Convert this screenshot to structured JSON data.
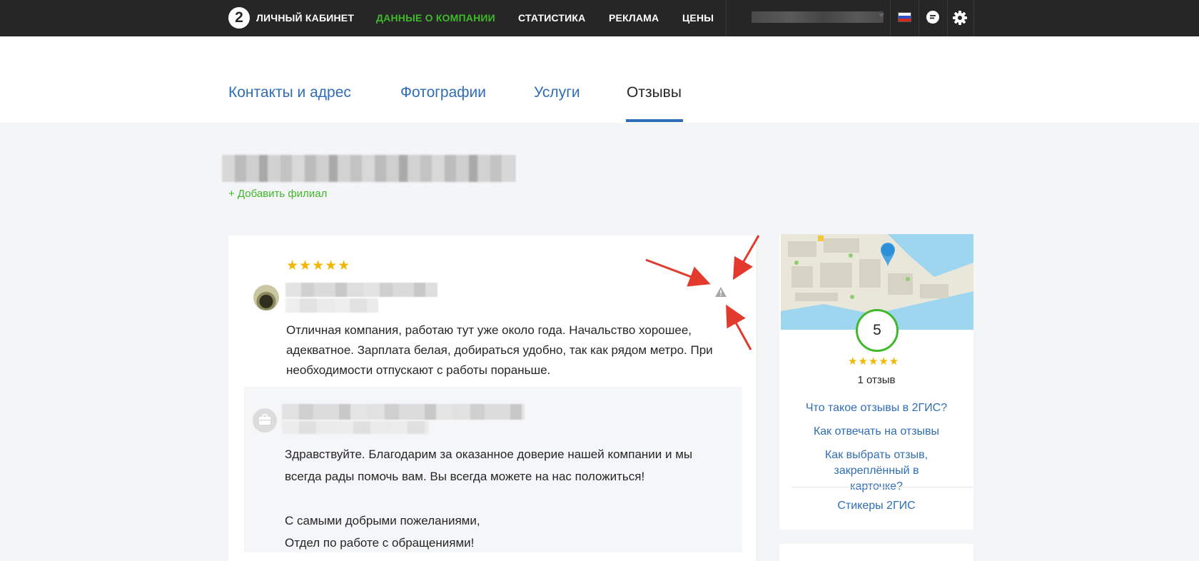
{
  "topbar": {
    "logo_text": "2",
    "brand": "ЛИЧНЫЙ КАБИНЕТ",
    "nav": [
      {
        "label": "ДАННЫЕ О КОМПАНИИ",
        "active": true
      },
      {
        "label": "СТАТИСТИКА",
        "active": false
      },
      {
        "label": "РЕКЛАМА",
        "active": false
      },
      {
        "label": "ЦЕНЫ",
        "active": false
      }
    ],
    "icons": [
      "flag-ru-icon",
      "chat-icon",
      "gear-icon"
    ],
    "colors": {
      "bg": "#262626",
      "active": "#3fb82a"
    }
  },
  "tabs": [
    {
      "label": "Контакты и адрес",
      "active": false
    },
    {
      "label": "Фотографии",
      "active": false
    },
    {
      "label": "Услуги",
      "active": false
    },
    {
      "label": "Отзывы",
      "active": true
    }
  ],
  "company": {
    "add_branch": "+ Добавить филиал"
  },
  "review": {
    "rating": 5,
    "stars": "★★★★★",
    "text": "Отличная компания, работаю тут уже около года. Начальство хорошее, адекватное. Зарплата белая, добираться удобно, так как рядом метро. При необходимости отпускают с работы пораньше.",
    "reply": {
      "line1": "Здравствуйте. Благодарим за оказанное доверие нашей компании и мы всегда рады помочь вам. Вы всегда можете на нас положиться!",
      "line2": "С самыми добрыми пожеланиями,",
      "line3": "Отдел по работе с обращениями!"
    }
  },
  "sidebar": {
    "rating": "5",
    "stars": "★★★★★",
    "count": "1 отзыв",
    "links": [
      "Что такое отзывы в 2ГИС?",
      "Как отвечать на отзывы",
      "Как выбрать отзыв, закреплённый в карточке?",
      "Стикеры 2ГИС"
    ]
  }
}
